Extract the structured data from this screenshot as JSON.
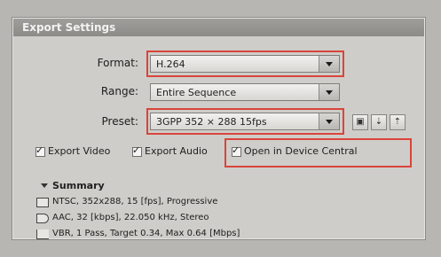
{
  "panel": {
    "title": "Export Settings"
  },
  "format": {
    "label": "Format:",
    "value": "H.264"
  },
  "range": {
    "label": "Range:",
    "value": "Entire Sequence"
  },
  "preset": {
    "label": "Preset:",
    "value": "3GPP 352 × 288 15fps"
  },
  "preset_buttons": {
    "save": "▣",
    "import": "⇣",
    "delete": "⇡"
  },
  "options": {
    "export_video": "Export Video",
    "export_audio": "Export Audio",
    "open_device_central": "Open in Device Central"
  },
  "summary": {
    "title": "Summary",
    "video": "NTSC, 352x288, 15 [fps], Progressive",
    "audio": "AAC, 32 [kbps], 22.050 kHz, Stereo",
    "bitrate": "VBR, 1 Pass, Target 0.34, Max 0.64 [Mbps]"
  },
  "colors": {
    "highlight": "#d8453b",
    "panel": "#cfcdc9",
    "header": "#8c8b88"
  },
  "icons": {
    "video": "film-icon",
    "audio": "speaker-icon",
    "bitrate": "bitrate-icon",
    "dropdown": "chevron-down-icon",
    "summary_toggle": "disclosure-triangle-icon"
  }
}
